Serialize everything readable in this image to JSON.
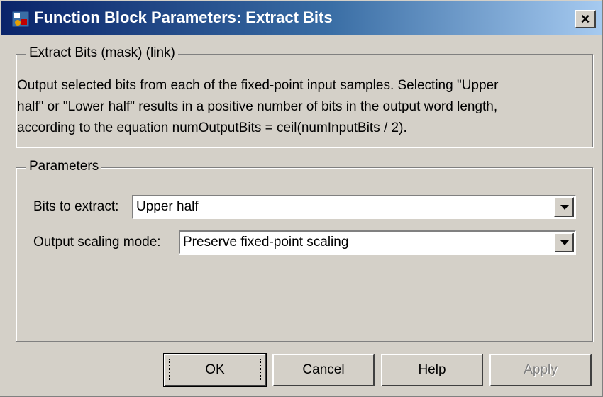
{
  "window": {
    "title": "Function Block Parameters: Extract Bits",
    "close_label": "×"
  },
  "description_group": {
    "legend": "Extract Bits (mask) (link)",
    "lines": [
      "Output selected bits from each of the fixed-point input samples. Selecting \"Upper",
      "half\" or \"Lower half\" results in a positive number of bits in the output word length,",
      "according to the equation numOutputBits = ceil(numInputBits / 2)."
    ]
  },
  "parameters_group": {
    "legend": "Parameters",
    "bits_to_extract": {
      "label": "Bits to extract:",
      "value": "Upper half"
    },
    "output_scaling_mode": {
      "label": "Output scaling mode:",
      "value": "Preserve fixed-point scaling"
    }
  },
  "buttons": {
    "ok": "OK",
    "cancel": "Cancel",
    "help": "Help",
    "apply": "Apply"
  },
  "icons": {
    "app": "simulink-block-icon",
    "close": "close-icon",
    "dropdown": "chevron-down-icon"
  },
  "colors": {
    "titlebar_start": "#0a246a",
    "titlebar_end": "#a6caf0",
    "dialog_bg": "#d4d0c8"
  }
}
